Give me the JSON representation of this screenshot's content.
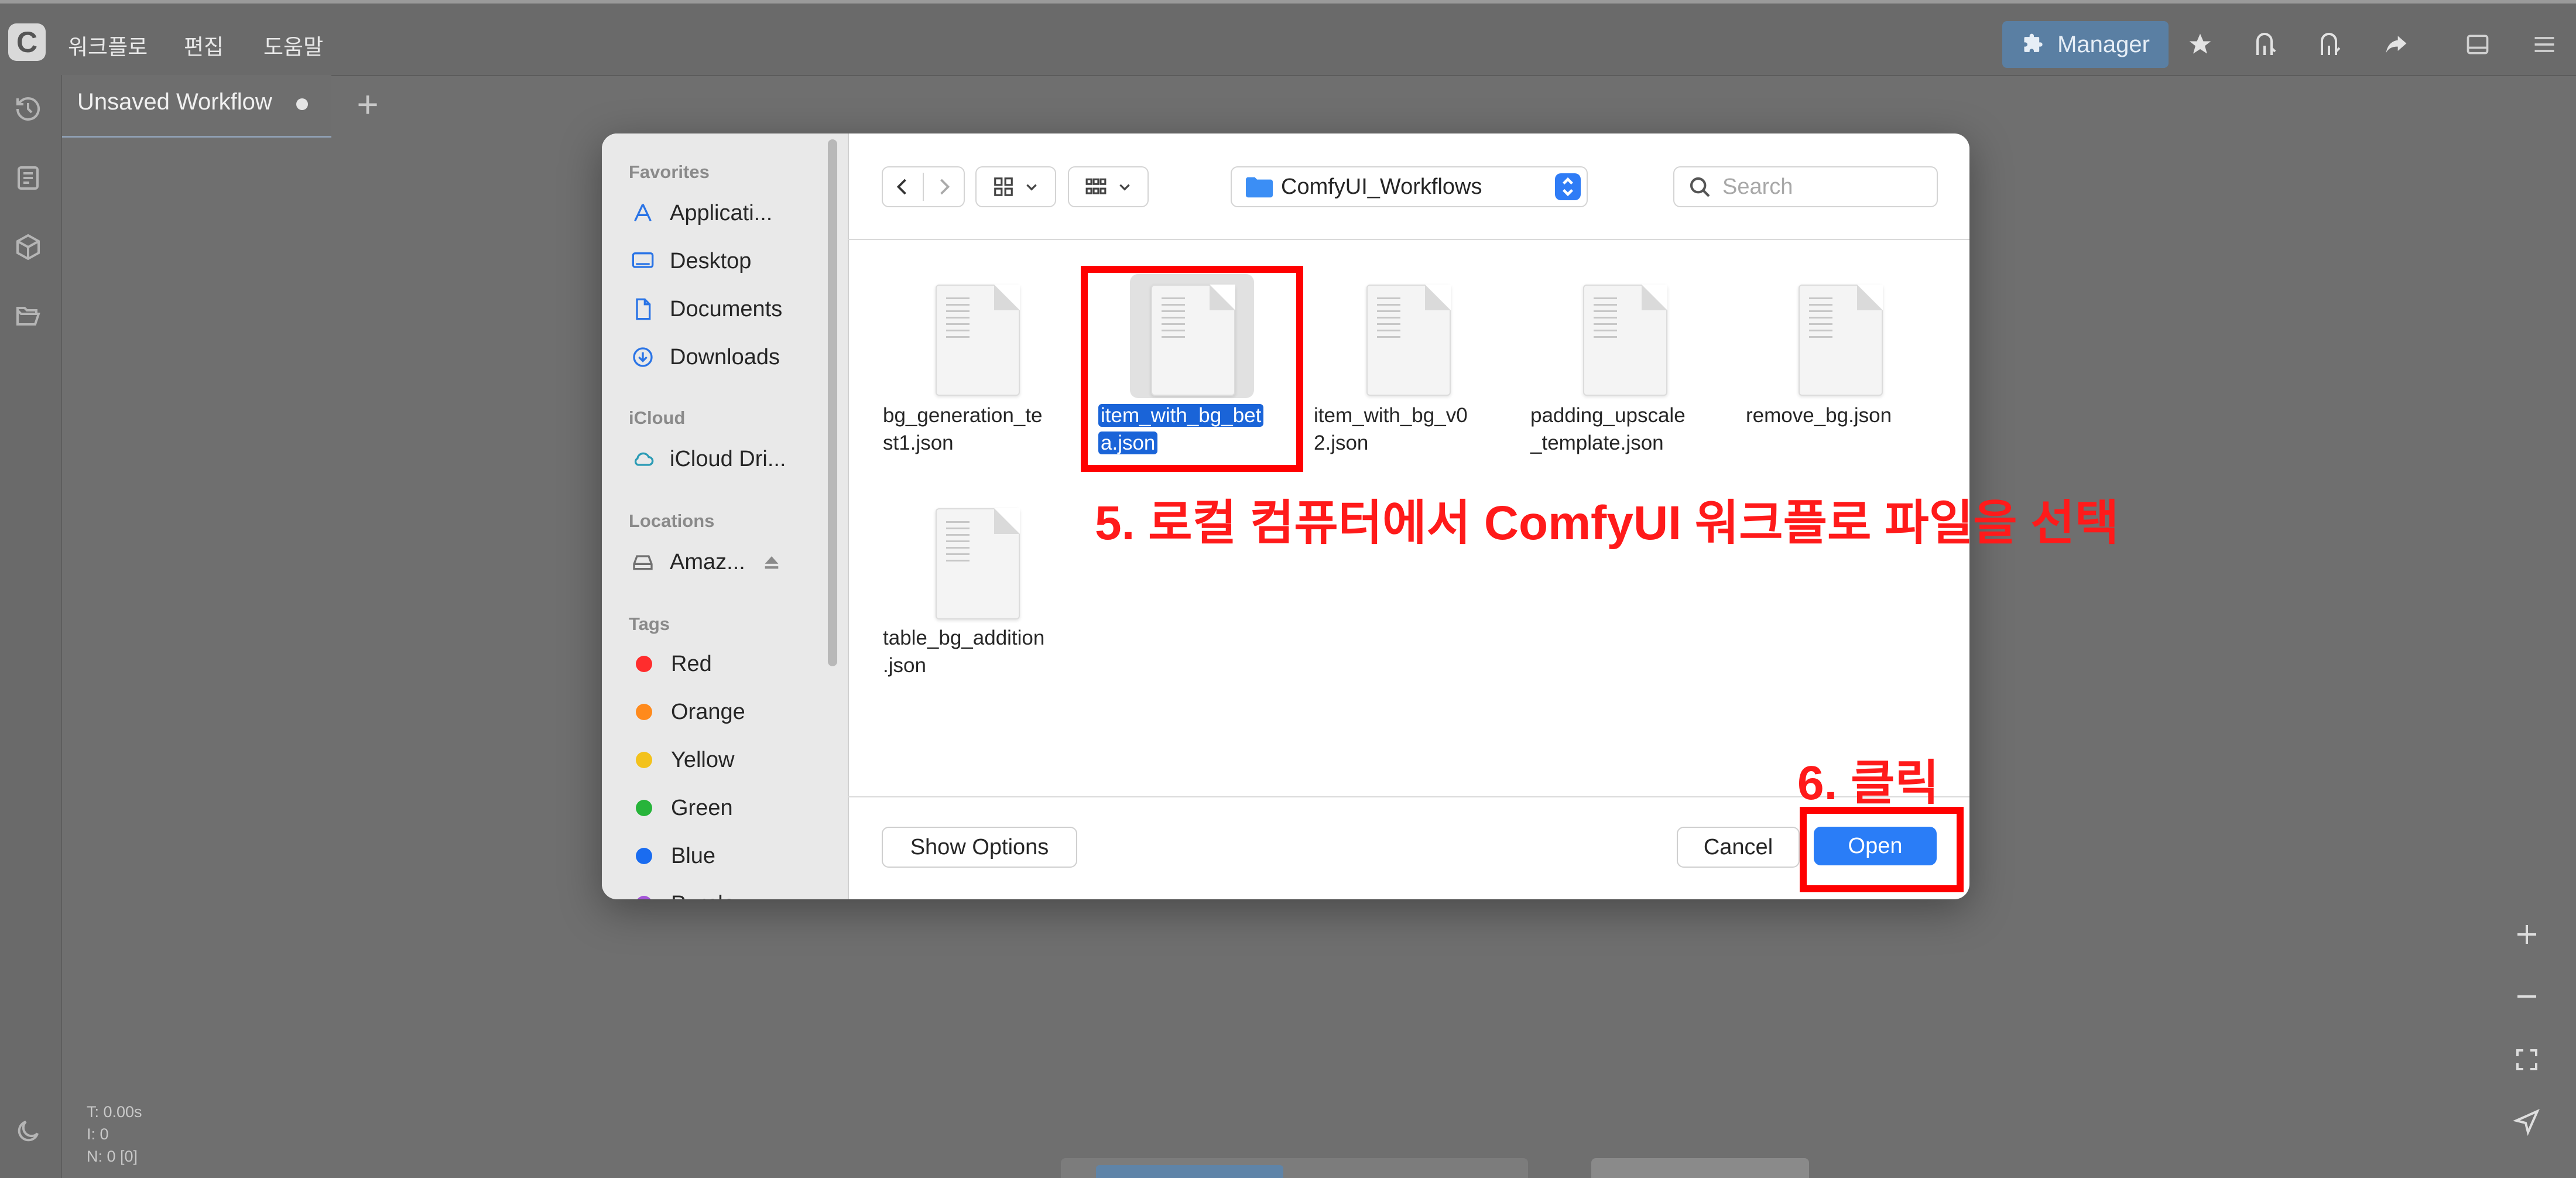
{
  "app": {
    "menu": [
      "워크플로",
      "편집",
      "도움말"
    ],
    "manager_label": "Manager",
    "top_icons": [
      "star-icon",
      "graph-icon",
      "graph-icon-2",
      "share-icon",
      "panel-icon",
      "hamburger-menu-icon"
    ]
  },
  "tabs": [
    {
      "label": "Unsaved Workflow",
      "unsaved": true
    }
  ],
  "canvas_stats": [
    "T: 0.00s",
    "I: 0",
    "N: 0 [0]"
  ],
  "dialog": {
    "toolbar": {
      "path": "ComfyUI_Workflows",
      "search_placeholder": "Search"
    },
    "sidebar": {
      "favorites_title": "Favorites",
      "favorites": [
        {
          "label": "Applicati...",
          "icon": "applications-icon"
        },
        {
          "label": "Desktop",
          "icon": "desktop-icon"
        },
        {
          "label": "Documents",
          "icon": "document-icon"
        },
        {
          "label": "Downloads",
          "icon": "download-icon"
        }
      ],
      "icloud_title": "iCloud",
      "icloud": [
        {
          "label": "iCloud Dri...",
          "icon": "cloud-icon"
        }
      ],
      "locations_title": "Locations",
      "locations": [
        {
          "label": "Amaz...",
          "icon": "drive-icon"
        }
      ],
      "tags_title": "Tags",
      "tags": [
        {
          "label": "Red",
          "color": "#ff2d2d"
        },
        {
          "label": "Orange",
          "color": "#ff8a1c"
        },
        {
          "label": "Yellow",
          "color": "#f3c21c"
        },
        {
          "label": "Green",
          "color": "#27b43a"
        },
        {
          "label": "Blue",
          "color": "#1a6cf0"
        },
        {
          "label": "Purple",
          "color": "#a455d8"
        }
      ]
    },
    "files": [
      {
        "line1": "bg_generation_te",
        "line2": "st1.json",
        "selected": false
      },
      {
        "line1": "item_with_bg_bet",
        "line2": "a.json",
        "selected": true
      },
      {
        "line1": "item_with_bg_v0",
        "line2": "2.json",
        "selected": false
      },
      {
        "line1": "padding_upscale",
        "line2": "_template.json",
        "selected": false
      },
      {
        "line1": "remove_bg.json",
        "line2": "",
        "selected": false
      },
      {
        "line1": "table_bg_addition",
        "line2": ".json",
        "selected": false
      }
    ],
    "buttons": {
      "show_options": "Show Options",
      "cancel": "Cancel",
      "open": "Open"
    }
  },
  "annotations": {
    "step5": "5. 로컬 컴퓨터에서 ComfyUI 워크플로 파일을 선택",
    "step6": "6. 클릭",
    "color": "#ff0000"
  }
}
